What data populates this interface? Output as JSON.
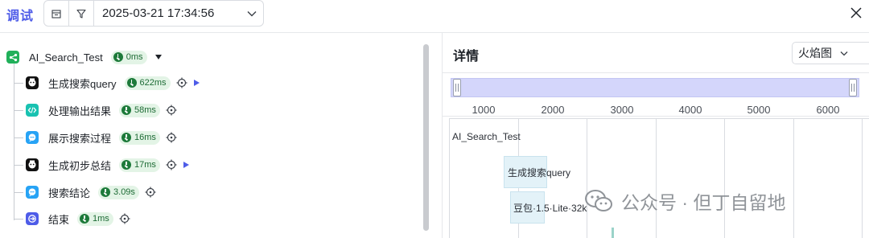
{
  "header": {
    "title": "调试",
    "datetime": "2025-03-21 17:34:56"
  },
  "tree": {
    "root": {
      "label": "AI_Search_Test",
      "duration": "0ms"
    },
    "nodes": [
      {
        "label": "生成搜索query",
        "duration": "622ms",
        "icon": "bot-icon",
        "color": "#111111",
        "has_play": true
      },
      {
        "label": "处理输出结果",
        "duration": "58ms",
        "icon": "code-icon",
        "color": "#19c2b1",
        "has_play": false
      },
      {
        "label": "展示搜索过程",
        "duration": "16ms",
        "icon": "message-icon",
        "color": "#27a3f5",
        "has_play": false
      },
      {
        "label": "生成初步总结",
        "duration": "17ms",
        "icon": "bot-icon",
        "color": "#111111",
        "has_play": true
      },
      {
        "label": "搜索结论",
        "duration": "3.09s",
        "icon": "message-icon",
        "color": "#27a3f5",
        "has_play": false
      },
      {
        "label": "结束",
        "duration": "1ms",
        "icon": "exit-icon",
        "color": "#4e5ce8",
        "has_play": false
      }
    ]
  },
  "details": {
    "title": "详情",
    "view_select": "火焰图",
    "axis_ticks": [
      "1000",
      "2000",
      "3000",
      "4000",
      "5000",
      "6000"
    ],
    "flame": {
      "root_label": "AI_Search_Test",
      "bar1_label": "生成搜索query",
      "bar2_label": "豆包·1.5·Lite·32k"
    }
  },
  "watermark": {
    "text": "公众号 · 但丁自留地"
  },
  "colors": {
    "accent": "#4e5ce8",
    "badge_bg": "#e3f4e6",
    "badge_icon": "#1d7a3a",
    "range_fill": "#d4d6fb",
    "flame_box": "#e3f2f8"
  }
}
